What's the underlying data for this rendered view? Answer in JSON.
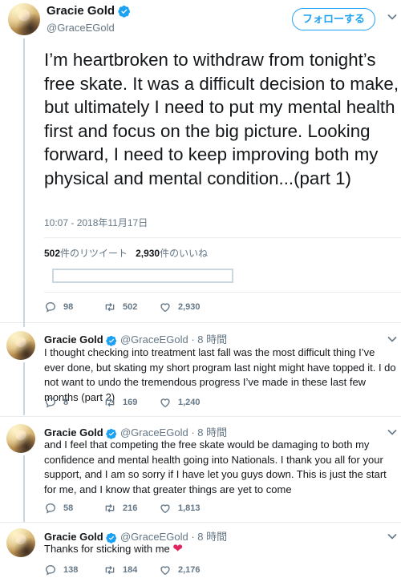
{
  "main_tweet": {
    "display_name": "Gracie Gold",
    "handle": "@GraceEGold",
    "follow_label": "フォローする",
    "text": "I’m heartbroken to withdraw from tonight’s free skate. It was a difficult decision to make, but ultimately I need to put my mental health first and focus on the big picture. Looking forward, I need to keep improving both my physical and mental condition...(part 1)",
    "timestamp": "10:07 - 2018年11月17日",
    "retweet_count": "502",
    "retweet_label": "件のリツイート",
    "like_count": "2,930",
    "like_label": "件のいいね",
    "replies": "98",
    "retweets": "502",
    "likes": "2,930"
  },
  "replies": [
    {
      "display_name": "Gracie Gold",
      "handle": "@GraceEGold",
      "time": "· 8 時間",
      "text": "I thought checking into treatment last fall was the most difficult thing I’ve ever done, but skating my short program last night might have topped it. I do not want to undo the tremendous progress I’ve made in these last few months (part 2)",
      "replies": "8",
      "retweets": "169",
      "likes": "1,240"
    },
    {
      "display_name": "Gracie Gold",
      "handle": "@GraceEGold",
      "time": "· 8 時間",
      "text": "and I feel that competing the free skate would be damaging to both my confidence and mental health going into Nationals. I thank you all for your support, and I am so sorry if I have let you guys down. This is just the start for me, and I know that greater things are yet to come",
      "replies": "58",
      "retweets": "216",
      "likes": "1,813"
    },
    {
      "display_name": "Gracie Gold",
      "handle": "@GraceEGold",
      "time": "· 8 時間",
      "text": "Thanks for sticking with me",
      "emoji": "❤",
      "replies": "138",
      "retweets": "184",
      "likes": "2,176"
    }
  ],
  "colors": {
    "accent": "#1da1f2",
    "muted": "#657786",
    "heart": "#e0245e"
  }
}
